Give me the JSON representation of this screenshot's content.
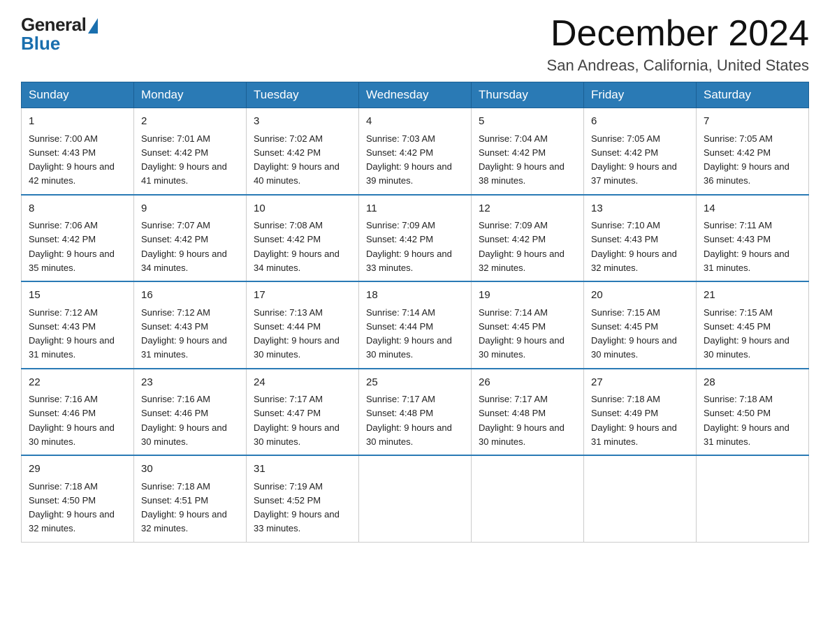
{
  "logo": {
    "general": "General",
    "blue": "Blue"
  },
  "title": "December 2024",
  "subtitle": "San Andreas, California, United States",
  "days_of_week": [
    "Sunday",
    "Monday",
    "Tuesday",
    "Wednesday",
    "Thursday",
    "Friday",
    "Saturday"
  ],
  "weeks": [
    [
      {
        "day": "1",
        "sunrise": "7:00 AM",
        "sunset": "4:43 PM",
        "daylight": "9 hours and 42 minutes."
      },
      {
        "day": "2",
        "sunrise": "7:01 AM",
        "sunset": "4:42 PM",
        "daylight": "9 hours and 41 minutes."
      },
      {
        "day": "3",
        "sunrise": "7:02 AM",
        "sunset": "4:42 PM",
        "daylight": "9 hours and 40 minutes."
      },
      {
        "day": "4",
        "sunrise": "7:03 AM",
        "sunset": "4:42 PM",
        "daylight": "9 hours and 39 minutes."
      },
      {
        "day": "5",
        "sunrise": "7:04 AM",
        "sunset": "4:42 PM",
        "daylight": "9 hours and 38 minutes."
      },
      {
        "day": "6",
        "sunrise": "7:05 AM",
        "sunset": "4:42 PM",
        "daylight": "9 hours and 37 minutes."
      },
      {
        "day": "7",
        "sunrise": "7:05 AM",
        "sunset": "4:42 PM",
        "daylight": "9 hours and 36 minutes."
      }
    ],
    [
      {
        "day": "8",
        "sunrise": "7:06 AM",
        "sunset": "4:42 PM",
        "daylight": "9 hours and 35 minutes."
      },
      {
        "day": "9",
        "sunrise": "7:07 AM",
        "sunset": "4:42 PM",
        "daylight": "9 hours and 34 minutes."
      },
      {
        "day": "10",
        "sunrise": "7:08 AM",
        "sunset": "4:42 PM",
        "daylight": "9 hours and 34 minutes."
      },
      {
        "day": "11",
        "sunrise": "7:09 AM",
        "sunset": "4:42 PM",
        "daylight": "9 hours and 33 minutes."
      },
      {
        "day": "12",
        "sunrise": "7:09 AM",
        "sunset": "4:42 PM",
        "daylight": "9 hours and 32 minutes."
      },
      {
        "day": "13",
        "sunrise": "7:10 AM",
        "sunset": "4:43 PM",
        "daylight": "9 hours and 32 minutes."
      },
      {
        "day": "14",
        "sunrise": "7:11 AM",
        "sunset": "4:43 PM",
        "daylight": "9 hours and 31 minutes."
      }
    ],
    [
      {
        "day": "15",
        "sunrise": "7:12 AM",
        "sunset": "4:43 PM",
        "daylight": "9 hours and 31 minutes."
      },
      {
        "day": "16",
        "sunrise": "7:12 AM",
        "sunset": "4:43 PM",
        "daylight": "9 hours and 31 minutes."
      },
      {
        "day": "17",
        "sunrise": "7:13 AM",
        "sunset": "4:44 PM",
        "daylight": "9 hours and 30 minutes."
      },
      {
        "day": "18",
        "sunrise": "7:14 AM",
        "sunset": "4:44 PM",
        "daylight": "9 hours and 30 minutes."
      },
      {
        "day": "19",
        "sunrise": "7:14 AM",
        "sunset": "4:45 PM",
        "daylight": "9 hours and 30 minutes."
      },
      {
        "day": "20",
        "sunrise": "7:15 AM",
        "sunset": "4:45 PM",
        "daylight": "9 hours and 30 minutes."
      },
      {
        "day": "21",
        "sunrise": "7:15 AM",
        "sunset": "4:45 PM",
        "daylight": "9 hours and 30 minutes."
      }
    ],
    [
      {
        "day": "22",
        "sunrise": "7:16 AM",
        "sunset": "4:46 PM",
        "daylight": "9 hours and 30 minutes."
      },
      {
        "day": "23",
        "sunrise": "7:16 AM",
        "sunset": "4:46 PM",
        "daylight": "9 hours and 30 minutes."
      },
      {
        "day": "24",
        "sunrise": "7:17 AM",
        "sunset": "4:47 PM",
        "daylight": "9 hours and 30 minutes."
      },
      {
        "day": "25",
        "sunrise": "7:17 AM",
        "sunset": "4:48 PM",
        "daylight": "9 hours and 30 minutes."
      },
      {
        "day": "26",
        "sunrise": "7:17 AM",
        "sunset": "4:48 PM",
        "daylight": "9 hours and 30 minutes."
      },
      {
        "day": "27",
        "sunrise": "7:18 AM",
        "sunset": "4:49 PM",
        "daylight": "9 hours and 31 minutes."
      },
      {
        "day": "28",
        "sunrise": "7:18 AM",
        "sunset": "4:50 PM",
        "daylight": "9 hours and 31 minutes."
      }
    ],
    [
      {
        "day": "29",
        "sunrise": "7:18 AM",
        "sunset": "4:50 PM",
        "daylight": "9 hours and 32 minutes."
      },
      {
        "day": "30",
        "sunrise": "7:18 AM",
        "sunset": "4:51 PM",
        "daylight": "9 hours and 32 minutes."
      },
      {
        "day": "31",
        "sunrise": "7:19 AM",
        "sunset": "4:52 PM",
        "daylight": "9 hours and 33 minutes."
      },
      null,
      null,
      null,
      null
    ]
  ],
  "labels": {
    "sunrise": "Sunrise:",
    "sunset": "Sunset:",
    "daylight": "Daylight:"
  }
}
